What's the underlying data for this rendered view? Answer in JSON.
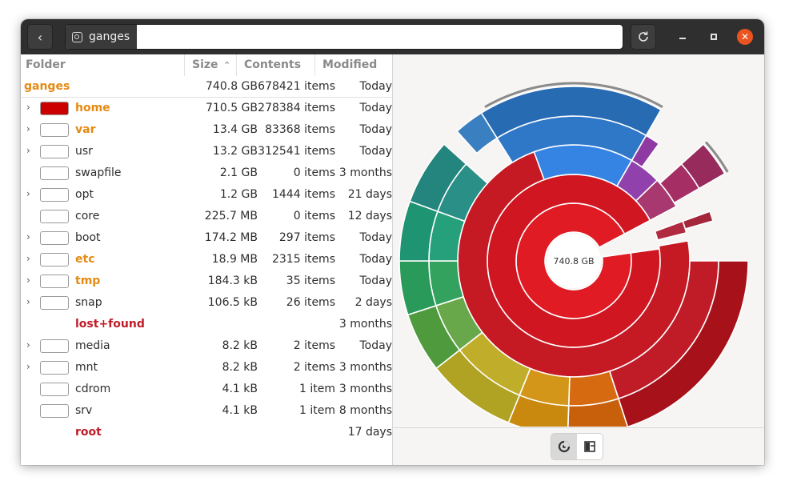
{
  "window": {
    "path": "ganges"
  },
  "columns": {
    "folder": "Folder",
    "size": "Size",
    "contents": "Contents",
    "modified": "Modified"
  },
  "root": {
    "name": "ganges",
    "size": "740.8 GB",
    "contents": "678421 items",
    "modified": "Today"
  },
  "rows": [
    {
      "name": "home",
      "size": "710.5 GB",
      "contents": "278384 items",
      "modified": "Today",
      "expander": true,
      "swatch": true,
      "color": "#cc0000",
      "style": "orange"
    },
    {
      "name": "var",
      "size": "13.4 GB",
      "contents": "83368 items",
      "modified": "Today",
      "expander": true,
      "swatch": true,
      "color": "#ffffff",
      "style": "orange"
    },
    {
      "name": "usr",
      "size": "13.2 GB",
      "contents": "312541 items",
      "modified": "Today",
      "expander": true,
      "swatch": true,
      "color": "#ffffff",
      "style": "normal"
    },
    {
      "name": "swapfile",
      "size": "2.1 GB",
      "contents": "0 items",
      "modified": "3 months",
      "expander": false,
      "swatch": true,
      "color": "#ffffff",
      "style": "normal"
    },
    {
      "name": "opt",
      "size": "1.2 GB",
      "contents": "1444 items",
      "modified": "21 days",
      "expander": true,
      "swatch": true,
      "color": "#ffffff",
      "style": "normal"
    },
    {
      "name": "core",
      "size": "225.7 MB",
      "contents": "0 items",
      "modified": "12 days",
      "expander": false,
      "swatch": true,
      "color": "#ffffff",
      "style": "normal"
    },
    {
      "name": "boot",
      "size": "174.2 MB",
      "contents": "297 items",
      "modified": "Today",
      "expander": true,
      "swatch": true,
      "color": "#ffffff",
      "style": "normal"
    },
    {
      "name": "etc",
      "size": "18.9 MB",
      "contents": "2315 items",
      "modified": "Today",
      "expander": true,
      "swatch": true,
      "color": "#ffffff",
      "style": "orange"
    },
    {
      "name": "tmp",
      "size": "184.3 kB",
      "contents": "35 items",
      "modified": "Today",
      "expander": true,
      "swatch": true,
      "color": "#ffffff",
      "style": "orange"
    },
    {
      "name": "snap",
      "size": "106.5 kB",
      "contents": "26 items",
      "modified": "2 days",
      "expander": true,
      "swatch": true,
      "color": "#ffffff",
      "style": "normal"
    },
    {
      "name": "lost+found",
      "size": "",
      "contents": "",
      "modified": "3 months",
      "expander": false,
      "swatch": false,
      "color": "#ffffff",
      "style": "red"
    },
    {
      "name": "media",
      "size": "8.2 kB",
      "contents": "2 items",
      "modified": "Today",
      "expander": true,
      "swatch": true,
      "color": "#ffffff",
      "style": "normal"
    },
    {
      "name": "mnt",
      "size": "8.2 kB",
      "contents": "2 items",
      "modified": "3 months",
      "expander": true,
      "swatch": true,
      "color": "#ffffff",
      "style": "normal"
    },
    {
      "name": "cdrom",
      "size": "4.1 kB",
      "contents": "1 item",
      "modified": "3 months",
      "expander": false,
      "swatch": true,
      "color": "#ffffff",
      "style": "normal"
    },
    {
      "name": "srv",
      "size": "4.1 kB",
      "contents": "1 item",
      "modified": "8 months",
      "expander": false,
      "swatch": true,
      "color": "#ffffff",
      "style": "normal"
    },
    {
      "name": "root",
      "size": "",
      "contents": "",
      "modified": "17 days",
      "expander": false,
      "swatch": false,
      "color": "#ffffff",
      "style": "red"
    }
  ],
  "ring_chart": {
    "center_label": "740.8 GB"
  },
  "icons": {
    "back": "chevron-left-icon",
    "disk": "drive-icon",
    "reload": "reload-icon",
    "sort": "sort-ascending-icon",
    "ring_view": "ring-chart-icon",
    "treemap_view": "treemap-icon"
  }
}
